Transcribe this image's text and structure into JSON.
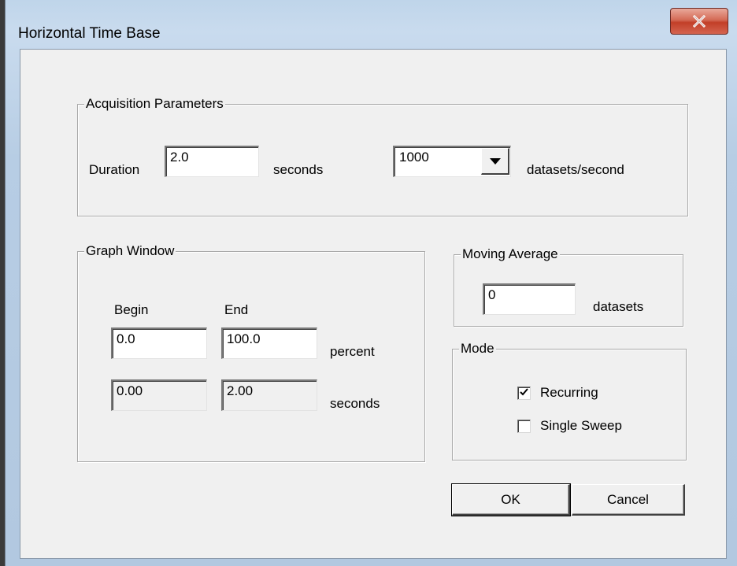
{
  "window": {
    "title": "Horizontal Time Base",
    "close_glyph": "✕"
  },
  "acquisition": {
    "group_label": "Acquisition Parameters",
    "duration_label": "Duration",
    "duration_value": "2.0",
    "duration_unit": "seconds",
    "rate_value": "1000",
    "rate_unit": "datasets/second"
  },
  "graph_window": {
    "group_label": "Graph Window",
    "begin_label": "Begin",
    "end_label": "End",
    "begin_percent": "0.0",
    "end_percent": "100.0",
    "percent_unit": "percent",
    "begin_seconds": "0.00",
    "end_seconds": "2.00",
    "seconds_unit": "seconds"
  },
  "moving_average": {
    "group_label": "Moving Average",
    "value": "0",
    "unit": "datasets"
  },
  "mode": {
    "group_label": "Mode",
    "options": [
      {
        "label": "Recurring",
        "checked": true
      },
      {
        "label": "Single Sweep",
        "checked": false
      }
    ]
  },
  "buttons": {
    "ok": "OK",
    "cancel": "Cancel"
  },
  "icons": {
    "close": "close-icon",
    "dropdown": "chevron-down-icon",
    "check": "check-icon"
  }
}
